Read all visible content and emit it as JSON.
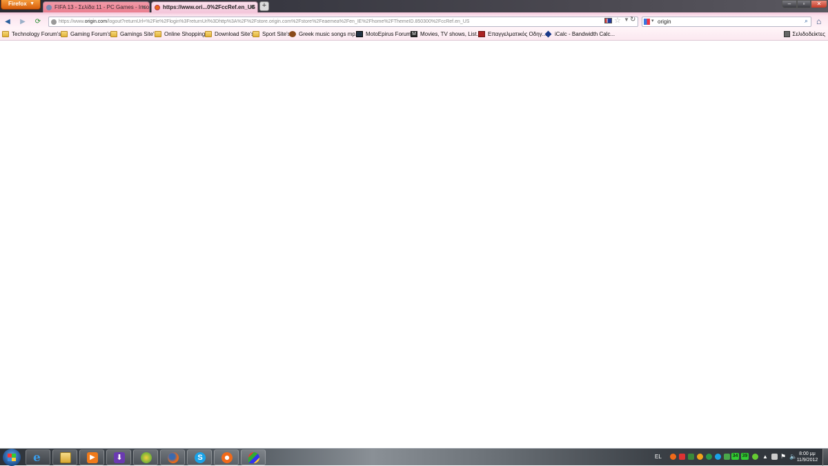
{
  "browser": {
    "menu_button": "Firefox",
    "tabs": [
      {
        "label": "FIFA 13 - Σελίδα 11 - PC Games - Inso..."
      },
      {
        "label": "https://www.ori...0%2FccRef.en_US"
      }
    ],
    "new_tab": "+",
    "window_controls": {
      "minimize": "–",
      "maximize": "▫",
      "close": "✕"
    }
  },
  "navigation": {
    "url_prefix": "https://www.",
    "url_host": "origin.com",
    "url_path": "/logout?returnUrl=%2Fie%2Flogin%3FreturnUrl%3Dhttp%3A%2F%2Fstore.origin.com%2Fstore%2Feaemea%2Fen_IE%2Fhome%2FThemeID.850300%2FccRef.en_US",
    "search_value": "origin",
    "icons": [
      "back-arrow-icon",
      "forward-arrow-icon",
      "refresh-icon",
      "star-icon",
      "search-icon",
      "home-icon"
    ]
  },
  "bookmarks": {
    "items": [
      {
        "label": "Technology Forum's",
        "icon": "folder-icon"
      },
      {
        "label": "Gaming Forum's",
        "icon": "folder-icon"
      },
      {
        "label": "Gamings Site's",
        "icon": "folder-icon"
      },
      {
        "label": "Online Shopping",
        "icon": "folder-icon"
      },
      {
        "label": "Download Site's",
        "icon": "folder-icon"
      },
      {
        "label": "Sport Site's",
        "icon": "folder-icon"
      },
      {
        "label": "Greek music songs mp...",
        "icon": "site-icon"
      },
      {
        "label": "MotoEpirus Forum",
        "icon": "site-icon"
      },
      {
        "label": "Movies, TV shows, List...",
        "icon": "site-icon"
      },
      {
        "label": "Επαγγελματικός Οδηγ...",
        "icon": "site-icon"
      },
      {
        "label": "iCalc - Bandwidth Calc...",
        "icon": "site-icon"
      }
    ],
    "right_label": "Σελιδοδείκτες"
  },
  "taskbar": {
    "apps": [
      "internet-explorer-icon",
      "file-explorer-icon",
      "media-player-icon",
      "download-manager-icon",
      "app-icon",
      "firefox-icon",
      "skype-icon",
      "origin-icon",
      "paint-icon"
    ],
    "language": "EL",
    "clock_time": "8:00 μμ",
    "clock_date": "11/9/2012",
    "tray_badges": [
      "34",
      "39"
    ]
  },
  "colors": {
    "firefox_button": "#e0701a",
    "active_tab": "#f3c6da",
    "inactive_tab": "#e97e8f",
    "toolbar": "#fbe3ee"
  }
}
